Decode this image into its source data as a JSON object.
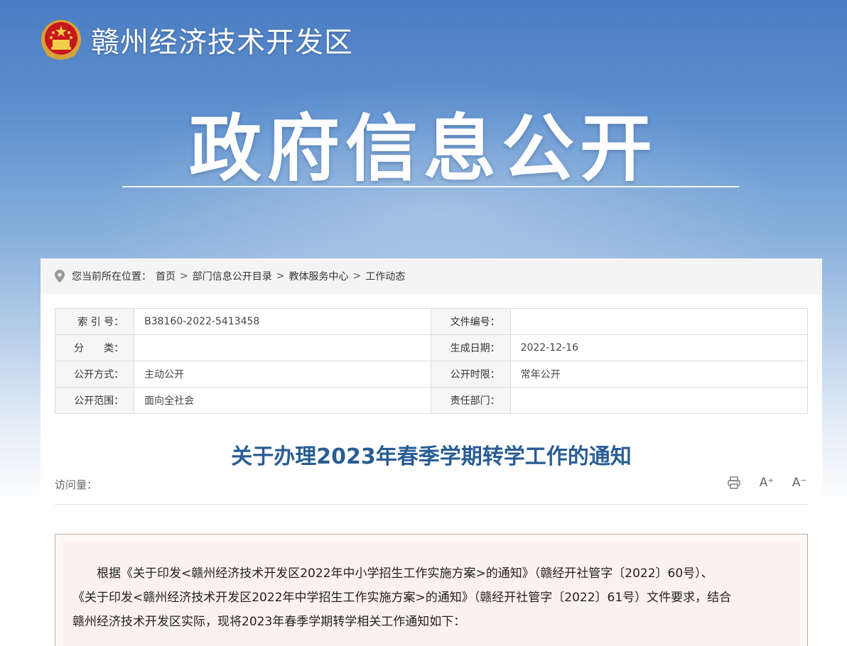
{
  "header": {
    "site_title": "赣州经济技术开发区",
    "banner_title": "政府信息公开"
  },
  "breadcrumb": {
    "prefix": "您当前所在位置：",
    "items": [
      "首页",
      "部门信息公开目录",
      "教体服务中心",
      "工作动态"
    ],
    "separator": ">"
  },
  "meta": {
    "rows": [
      {
        "l1": "索 引 号：",
        "v1": "B38160-2022-5413458",
        "l2": "文件编号：",
        "v2": ""
      },
      {
        "l1": "分　　类：",
        "v1": "",
        "l2": "生成日期：",
        "v2": "2022-12-16"
      },
      {
        "l1": "公开方式：",
        "v1": "主动公开",
        "l2": "公开时限：",
        "v2": "常年公开"
      },
      {
        "l1": "公开范围：",
        "v1": "面向全社会",
        "l2": "责任部门：",
        "v2": ""
      }
    ]
  },
  "article": {
    "title": "关于办理2023年春季学期转学工作的通知",
    "visits_label": "访问量：",
    "tools": {
      "print": "⎙",
      "font_up": "A⁺",
      "font_down": "A⁻"
    },
    "lines": [
      "　　根据《关于印发<赣州经济技术开发区2022年中小学招生工作实施方案>的通知》（赣经开社管字〔2022〕60号）、",
      "《关于印发<赣州经济技术开发区2022年中学招生工作实施方案>的通知》（赣经开社管字〔2022〕61号）文件要求，结合",
      "赣州经济技术开发区实际，现将2023年春季学期转学相关工作通知如下："
    ]
  },
  "colors": {
    "title_blue": "#2a5d93",
    "banner_blue": "#4a7cc2"
  },
  "icons": {
    "emblem": "national-emblem-icon",
    "location": "location-pin-icon",
    "print": "printer-icon",
    "font_up": "font-increase-icon",
    "font_down": "font-decrease-icon"
  }
}
